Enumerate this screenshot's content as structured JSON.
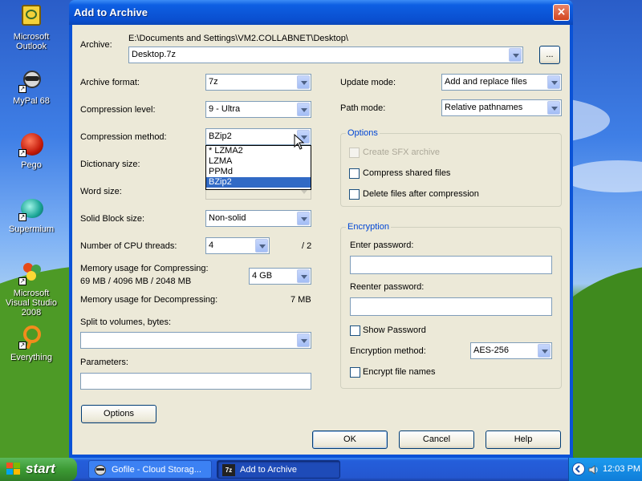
{
  "desktop": {
    "icons": [
      {
        "name": "outlook",
        "label": "Microsoft Outlook"
      },
      {
        "name": "mypal",
        "label": "MyPal 68"
      },
      {
        "name": "pego",
        "label": "Pego"
      },
      {
        "name": "supermium",
        "label": "Supermium"
      },
      {
        "name": "vs2008",
        "label": "Microsoft Visual Studio 2008"
      },
      {
        "name": "everything",
        "label": "Everything"
      }
    ]
  },
  "window": {
    "title": "Add to Archive",
    "close_icon": "×"
  },
  "archive": {
    "label": "Archive:",
    "path": "E:\\Documents and Settings\\VM2.COLLABNET\\Desktop\\",
    "name": "Desktop.7z",
    "browse_label": "..."
  },
  "left": {
    "format_label": "Archive format:",
    "format_value": "7z",
    "level_label": "Compression level:",
    "level_value": "9 - Ultra",
    "method_label": "Compression method:",
    "method_value": "BZip2",
    "method_options": [
      "* LZMA2",
      "LZMA",
      "PPMd",
      "BZip2"
    ],
    "dict_label": "Dictionary size:",
    "word_label": "Word size:",
    "solid_label": "Solid Block size:",
    "solid_value": "Non-solid",
    "threads_label": "Number of CPU threads:",
    "threads_value": "4",
    "threads_max": "/ 2",
    "mem_comp_label": "Memory usage for Compressing:",
    "mem_comp_values": "69 MB / 4096 MB / 2048 MB",
    "mem_comp_select": "4 GB",
    "mem_decomp_label": "Memory usage for Decompressing:",
    "mem_decomp_value": "7 MB",
    "split_label": "Split to volumes, bytes:",
    "split_value": "",
    "params_label": "Parameters:",
    "params_value": "",
    "options_button": "Options"
  },
  "right": {
    "update_label": "Update mode:",
    "update_value": "Add and replace files",
    "path_label": "Path mode:",
    "path_value": "Relative pathnames",
    "options_group": "Options",
    "sfx_label": "Create SFX archive",
    "shared_label": "Compress shared files",
    "delete_label": "Delete files after compression",
    "encryption_group": "Encryption",
    "enter_pw_label": "Enter password:",
    "reenter_pw_label": "Reenter password:",
    "show_pw_label": "Show Password",
    "enc_method_label": "Encryption method:",
    "enc_method_value": "AES-256",
    "encrypt_names_label": "Encrypt file names"
  },
  "buttons": {
    "ok": "OK",
    "cancel": "Cancel",
    "help": "Help"
  },
  "taskbar": {
    "start_label": "start",
    "tasks": [
      {
        "label": "Gofile - Cloud Storag..."
      },
      {
        "label": "Add to Archive",
        "icon_text": "7z"
      }
    ],
    "clock": "12:03 PM"
  },
  "colors": {
    "titlebar": "#0a4fd0",
    "group_title": "#0046d5",
    "selection": "#316ac5",
    "start_green": "#3c9a34"
  }
}
